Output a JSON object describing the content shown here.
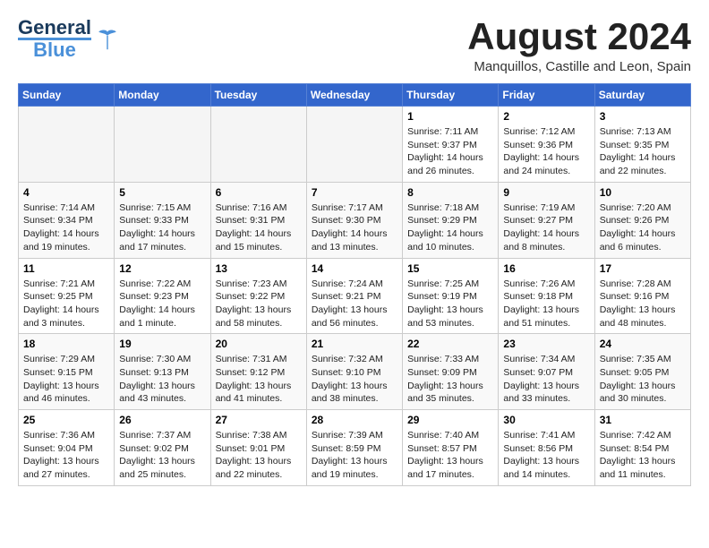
{
  "header": {
    "logo_line1": "General",
    "logo_line2": "Blue",
    "month_year": "August 2024",
    "location": "Manquillos, Castille and Leon, Spain"
  },
  "weekdays": [
    "Sunday",
    "Monday",
    "Tuesday",
    "Wednesday",
    "Thursday",
    "Friday",
    "Saturday"
  ],
  "weeks": [
    [
      {
        "day": "",
        "info": ""
      },
      {
        "day": "",
        "info": ""
      },
      {
        "day": "",
        "info": ""
      },
      {
        "day": "",
        "info": ""
      },
      {
        "day": "1",
        "info": "Sunrise: 7:11 AM\nSunset: 9:37 PM\nDaylight: 14 hours\nand 26 minutes."
      },
      {
        "day": "2",
        "info": "Sunrise: 7:12 AM\nSunset: 9:36 PM\nDaylight: 14 hours\nand 24 minutes."
      },
      {
        "day": "3",
        "info": "Sunrise: 7:13 AM\nSunset: 9:35 PM\nDaylight: 14 hours\nand 22 minutes."
      }
    ],
    [
      {
        "day": "4",
        "info": "Sunrise: 7:14 AM\nSunset: 9:34 PM\nDaylight: 14 hours\nand 19 minutes."
      },
      {
        "day": "5",
        "info": "Sunrise: 7:15 AM\nSunset: 9:33 PM\nDaylight: 14 hours\nand 17 minutes."
      },
      {
        "day": "6",
        "info": "Sunrise: 7:16 AM\nSunset: 9:31 PM\nDaylight: 14 hours\nand 15 minutes."
      },
      {
        "day": "7",
        "info": "Sunrise: 7:17 AM\nSunset: 9:30 PM\nDaylight: 14 hours\nand 13 minutes."
      },
      {
        "day": "8",
        "info": "Sunrise: 7:18 AM\nSunset: 9:29 PM\nDaylight: 14 hours\nand 10 minutes."
      },
      {
        "day": "9",
        "info": "Sunrise: 7:19 AM\nSunset: 9:27 PM\nDaylight: 14 hours\nand 8 minutes."
      },
      {
        "day": "10",
        "info": "Sunrise: 7:20 AM\nSunset: 9:26 PM\nDaylight: 14 hours\nand 6 minutes."
      }
    ],
    [
      {
        "day": "11",
        "info": "Sunrise: 7:21 AM\nSunset: 9:25 PM\nDaylight: 14 hours\nand 3 minutes."
      },
      {
        "day": "12",
        "info": "Sunrise: 7:22 AM\nSunset: 9:23 PM\nDaylight: 14 hours\nand 1 minute."
      },
      {
        "day": "13",
        "info": "Sunrise: 7:23 AM\nSunset: 9:22 PM\nDaylight: 13 hours\nand 58 minutes."
      },
      {
        "day": "14",
        "info": "Sunrise: 7:24 AM\nSunset: 9:21 PM\nDaylight: 13 hours\nand 56 minutes."
      },
      {
        "day": "15",
        "info": "Sunrise: 7:25 AM\nSunset: 9:19 PM\nDaylight: 13 hours\nand 53 minutes."
      },
      {
        "day": "16",
        "info": "Sunrise: 7:26 AM\nSunset: 9:18 PM\nDaylight: 13 hours\nand 51 minutes."
      },
      {
        "day": "17",
        "info": "Sunrise: 7:28 AM\nSunset: 9:16 PM\nDaylight: 13 hours\nand 48 minutes."
      }
    ],
    [
      {
        "day": "18",
        "info": "Sunrise: 7:29 AM\nSunset: 9:15 PM\nDaylight: 13 hours\nand 46 minutes."
      },
      {
        "day": "19",
        "info": "Sunrise: 7:30 AM\nSunset: 9:13 PM\nDaylight: 13 hours\nand 43 minutes."
      },
      {
        "day": "20",
        "info": "Sunrise: 7:31 AM\nSunset: 9:12 PM\nDaylight: 13 hours\nand 41 minutes."
      },
      {
        "day": "21",
        "info": "Sunrise: 7:32 AM\nSunset: 9:10 PM\nDaylight: 13 hours\nand 38 minutes."
      },
      {
        "day": "22",
        "info": "Sunrise: 7:33 AM\nSunset: 9:09 PM\nDaylight: 13 hours\nand 35 minutes."
      },
      {
        "day": "23",
        "info": "Sunrise: 7:34 AM\nSunset: 9:07 PM\nDaylight: 13 hours\nand 33 minutes."
      },
      {
        "day": "24",
        "info": "Sunrise: 7:35 AM\nSunset: 9:05 PM\nDaylight: 13 hours\nand 30 minutes."
      }
    ],
    [
      {
        "day": "25",
        "info": "Sunrise: 7:36 AM\nSunset: 9:04 PM\nDaylight: 13 hours\nand 27 minutes."
      },
      {
        "day": "26",
        "info": "Sunrise: 7:37 AM\nSunset: 9:02 PM\nDaylight: 13 hours\nand 25 minutes."
      },
      {
        "day": "27",
        "info": "Sunrise: 7:38 AM\nSunset: 9:01 PM\nDaylight: 13 hours\nand 22 minutes."
      },
      {
        "day": "28",
        "info": "Sunrise: 7:39 AM\nSunset: 8:59 PM\nDaylight: 13 hours\nand 19 minutes."
      },
      {
        "day": "29",
        "info": "Sunrise: 7:40 AM\nSunset: 8:57 PM\nDaylight: 13 hours\nand 17 minutes."
      },
      {
        "day": "30",
        "info": "Sunrise: 7:41 AM\nSunset: 8:56 PM\nDaylight: 13 hours\nand 14 minutes."
      },
      {
        "day": "31",
        "info": "Sunrise: 7:42 AM\nSunset: 8:54 PM\nDaylight: 13 hours\nand 11 minutes."
      }
    ]
  ]
}
